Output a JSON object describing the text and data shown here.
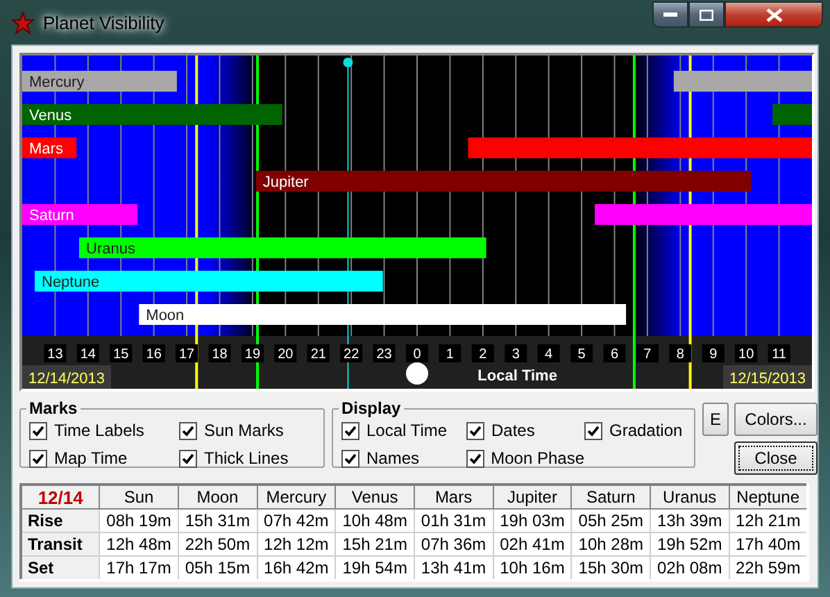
{
  "window": {
    "title": "Planet Visibility"
  },
  "chart": {
    "bars": [
      {
        "name": "Mercury",
        "color": "#a8a8a8"
      },
      {
        "name": "Venus",
        "color": "#006400"
      },
      {
        "name": "Mars",
        "color": "#ff0000"
      },
      {
        "name": "Jupiter",
        "color": "#800000"
      },
      {
        "name": "Saturn",
        "color": "#ff00ff"
      },
      {
        "name": "Uranus",
        "color": "#00ff00"
      },
      {
        "name": "Neptune",
        "color": "#00ffff"
      },
      {
        "name": "Moon",
        "color": "#ffffff"
      }
    ],
    "hours": [
      "13",
      "14",
      "15",
      "16",
      "17",
      "18",
      "19",
      "20",
      "21",
      "22",
      "23",
      "0",
      "1",
      "2",
      "3",
      "4",
      "5",
      "6",
      "7",
      "8",
      "9",
      "10",
      "11"
    ],
    "start_date": "12/14/2013",
    "end_date": "12/15/2013",
    "axis_label": "Local Time"
  },
  "marks": {
    "title": "Marks",
    "options": [
      {
        "label": "Time Labels",
        "checked": true
      },
      {
        "label": "Sun Marks",
        "checked": true
      },
      {
        "label": "Map Time",
        "checked": true
      },
      {
        "label": "Thick Lines",
        "checked": true
      }
    ]
  },
  "display": {
    "title": "Display",
    "options": [
      {
        "label": "Local Time",
        "checked": true
      },
      {
        "label": "Dates",
        "checked": true
      },
      {
        "label": "Gradation",
        "checked": true
      },
      {
        "label": "Names",
        "checked": true
      },
      {
        "label": "Moon Phase",
        "checked": true
      }
    ]
  },
  "buttons": [
    {
      "label": "E",
      "focused": false
    },
    {
      "label": "Colors...",
      "focused": false
    },
    {
      "label": "Close",
      "focused": true
    }
  ],
  "table": {
    "columns": [
      "12/14",
      "Sun",
      "Moon",
      "Mercury",
      "Venus",
      "Mars",
      "Jupiter",
      "Saturn",
      "Uranus",
      "Neptune"
    ],
    "rows": [
      {
        "label": "Rise",
        "values": [
          "08h 19m",
          "15h 31m",
          "07h 42m",
          "10h 48m",
          "01h 31m",
          "19h 03m",
          "05h 25m",
          "13h 39m",
          "12h 21m"
        ]
      },
      {
        "label": "Transit",
        "values": [
          "12h 48m",
          "22h 50m",
          "12h 12m",
          "15h 21m",
          "07h 36m",
          "02h 41m",
          "10h 28m",
          "19h 52m",
          "17h 40m"
        ]
      },
      {
        "label": "Set",
        "values": [
          "17h 17m",
          "05h 15m",
          "16h 42m",
          "19h 54m",
          "13h 41m",
          "10h 16m",
          "15h 30m",
          "02h 08m",
          "22h 59m"
        ]
      }
    ]
  }
}
